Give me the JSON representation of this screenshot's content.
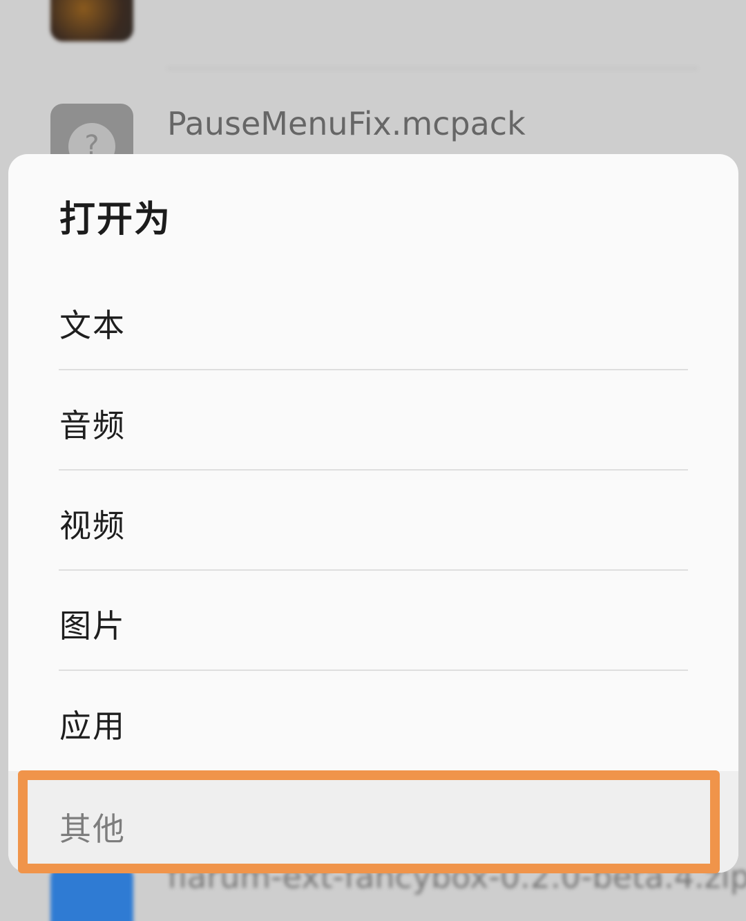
{
  "background": {
    "files": [
      {
        "name": "",
        "meta": ""
      },
      {
        "name": "PauseMenuFix.mcpack",
        "meta": "",
        "icon": "unknown-file-icon"
      },
      {
        "name": "flarum-ext-fancybox-0.2.0-beta.4.zip",
        "meta": ""
      }
    ]
  },
  "sheet": {
    "title": "打开为",
    "options": [
      {
        "label": "文本"
      },
      {
        "label": "音频"
      },
      {
        "label": "视频"
      },
      {
        "label": "图片"
      },
      {
        "label": "应用"
      },
      {
        "label": "其他"
      }
    ]
  },
  "colors": {
    "highlight": "#f0944a",
    "sheet_bg": "#fafafa",
    "scrim": "#cecece"
  }
}
